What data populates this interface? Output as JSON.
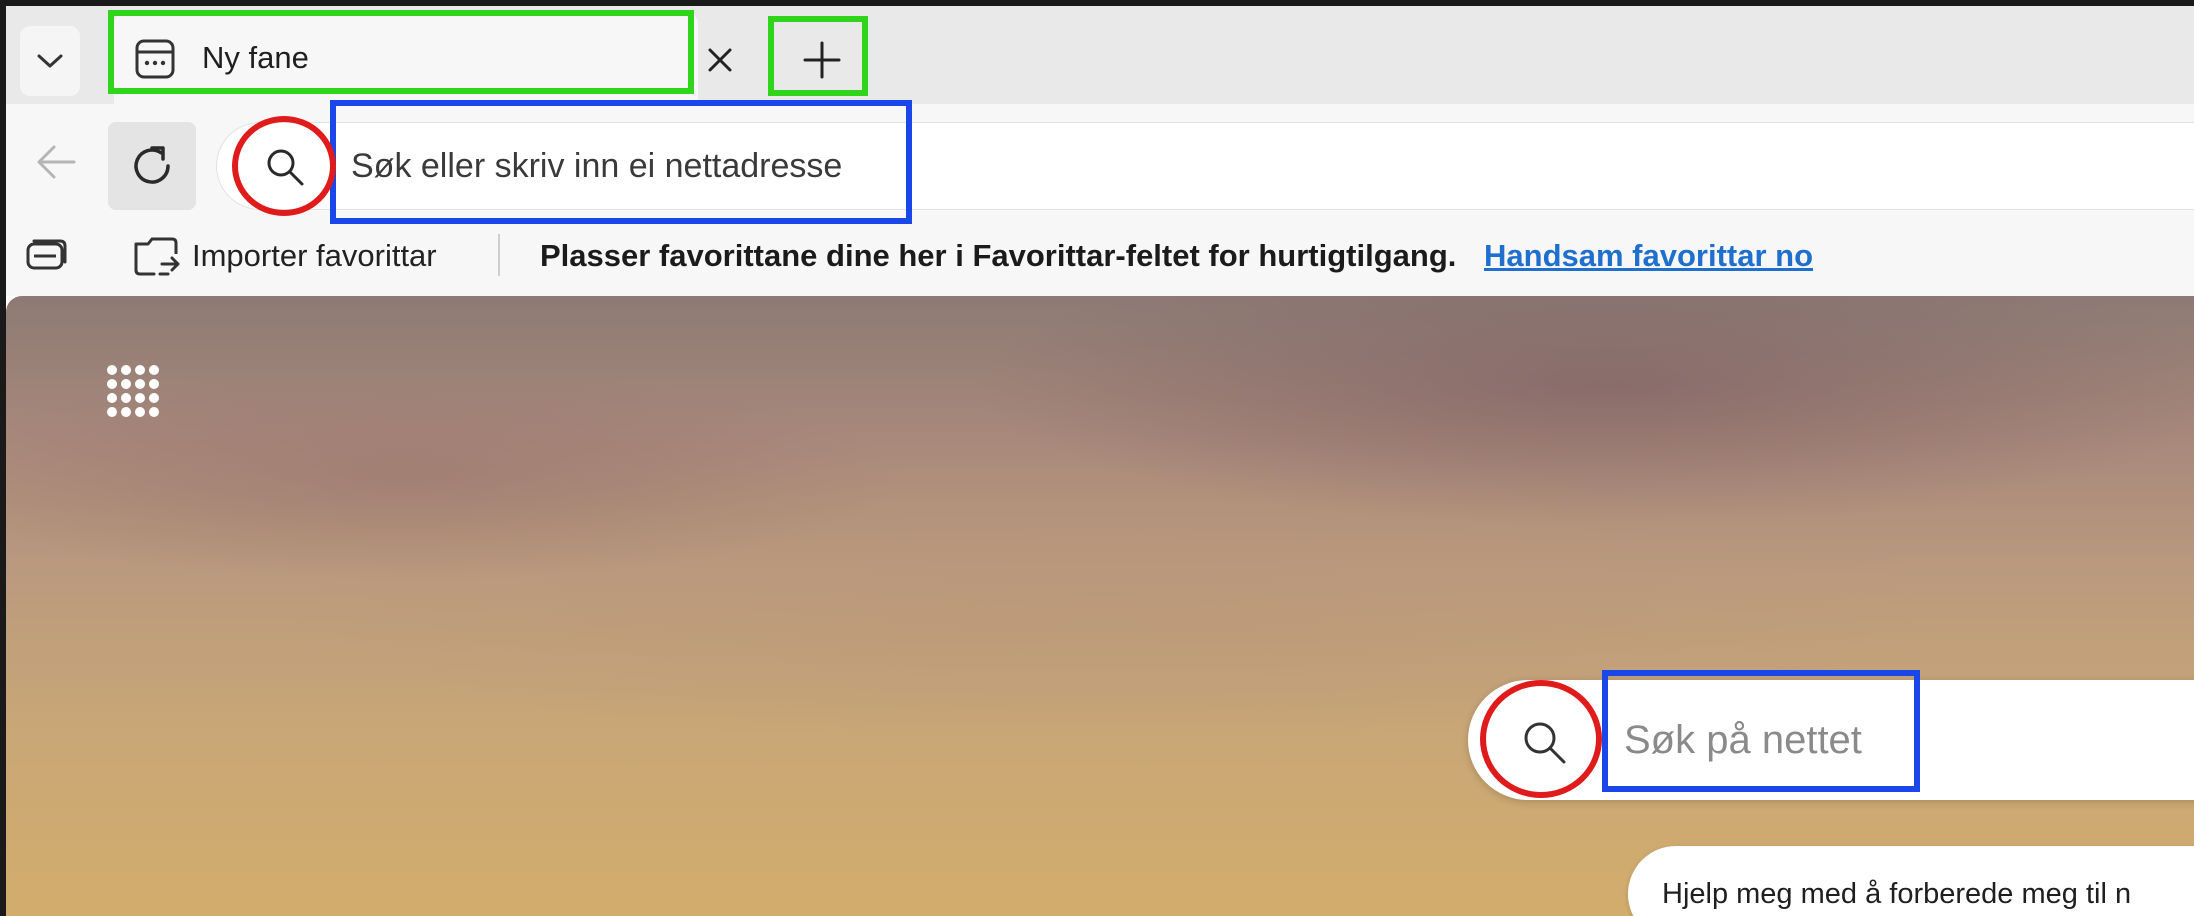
{
  "tabstrip": {
    "tab_menu_icon": "chevron-down-icon",
    "active_tab": {
      "title": "Ny fane",
      "icon": "newtab-page-icon"
    },
    "close_icon": "close-icon",
    "new_tab_icon": "plus-icon"
  },
  "toolbar": {
    "back_icon": "back-arrow-icon",
    "reload_icon": "reload-icon",
    "address": {
      "search_icon": "search-icon",
      "placeholder": "Søk eller skriv inn ei nettadresse"
    }
  },
  "favorites_bar": {
    "collections_icon": "collections-icon",
    "import_icon": "import-favorites-icon",
    "import_label": "Importer favorittar",
    "hint": "Plasser favorittane dine her i Favorittar-feltet for hurtigtilgang.",
    "manage_link": "Handsam favorittar no"
  },
  "new_tab_page": {
    "apps_icon": "app-launcher-icon",
    "web_search": {
      "search_icon": "search-icon",
      "placeholder": "Søk på nettet"
    },
    "suggestion_chip": "Hjelp meg med å forberede meg til n"
  },
  "colors": {
    "annotation_green": "#2fd51a",
    "annotation_blue": "#1a47ea",
    "annotation_red": "#e01b1b",
    "link": "#1f6fcf"
  }
}
